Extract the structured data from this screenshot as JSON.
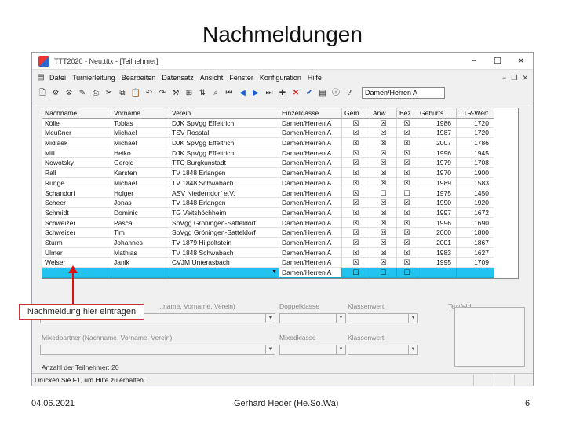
{
  "slide": {
    "title": "Nachmeldungen",
    "footer_date": "04.06.2021",
    "footer_author": "Gerhard Heder (He.So.Wa)",
    "footer_page": "6",
    "callout": "Nachmeldung hier eintragen"
  },
  "window": {
    "title": "TTT2020 - Neu.tttx - [Teilnehmer]",
    "minimize": "−",
    "maximize": "☐",
    "close": "✕"
  },
  "menu": [
    "Datei",
    "Turnierleitung",
    "Bearbeiten",
    "Datensatz",
    "Ansicht",
    "Fenster",
    "Konfiguration",
    "Hilfe"
  ],
  "mdi_controls": [
    "−",
    "❐",
    "✕"
  ],
  "toolbar": {
    "class_value": "Damen/Herren A"
  },
  "grid": {
    "headers": [
      "Nachname",
      "Vorname",
      "Verein",
      "Einzelklasse",
      "Gem.",
      "Anw.",
      "Bez.",
      "Geburts...",
      "TTR-Wert"
    ],
    "rows": [
      {
        "nachname": "Kölle",
        "vorname": "Tobias",
        "verein": "DJK SpVgg Effeltrich",
        "klasse": "Damen/Herren A",
        "gem": "☒",
        "anw": "☒",
        "bez": "☒",
        "geb": "1986",
        "ttr": "1720"
      },
      {
        "nachname": "Meußner",
        "vorname": "Michael",
        "verein": "TSV Rosstal",
        "klasse": "Damen/Herren A",
        "gem": "☒",
        "anw": "☒",
        "bez": "☒",
        "geb": "1987",
        "ttr": "1720"
      },
      {
        "nachname": "Midlaek",
        "vorname": "Michael",
        "verein": "DJK SpVgg Effeltrich",
        "klasse": "Damen/Herren A",
        "gem": "☒",
        "anw": "☒",
        "bez": "☒",
        "geb": "2007",
        "ttr": "1786"
      },
      {
        "nachname": "Mill",
        "vorname": "Heiko",
        "verein": "DJK SpVgg Effeltrich",
        "klasse": "Damen/Herren A",
        "gem": "☒",
        "anw": "☒",
        "bez": "☒",
        "geb": "1996",
        "ttr": "1945"
      },
      {
        "nachname": "Nowotsky",
        "vorname": "Gerold",
        "verein": "TTC Burgkunstadt",
        "klasse": "Damen/Herren A",
        "gem": "☒",
        "anw": "☒",
        "bez": "☒",
        "geb": "1979",
        "ttr": "1708"
      },
      {
        "nachname": "Rall",
        "vorname": "Karsten",
        "verein": "TV 1848 Erlangen",
        "klasse": "Damen/Herren A",
        "gem": "☒",
        "anw": "☒",
        "bez": "☒",
        "geb": "1970",
        "ttr": "1900"
      },
      {
        "nachname": "Runge",
        "vorname": "Michael",
        "verein": "TV 1848 Schwabach",
        "klasse": "Damen/Herren A",
        "gem": "☒",
        "anw": "☒",
        "bez": "☒",
        "geb": "1989",
        "ttr": "1583"
      },
      {
        "nachname": "Schandorf",
        "vorname": "Holger",
        "verein": "ASV Niederndorf e.V.",
        "klasse": "Damen/Herren A",
        "gem": "☒",
        "anw": "☐",
        "bez": "☐",
        "geb": "1975",
        "ttr": "1450"
      },
      {
        "nachname": "Scheer",
        "vorname": "Jonas",
        "verein": "TV 1848 Erlangen",
        "klasse": "Damen/Herren A",
        "gem": "☒",
        "anw": "☒",
        "bez": "☒",
        "geb": "1990",
        "ttr": "1920"
      },
      {
        "nachname": "Schmidt",
        "vorname": "Dominic",
        "verein": "TG Veitshöchheim",
        "klasse": "Damen/Herren A",
        "gem": "☒",
        "anw": "☒",
        "bez": "☒",
        "geb": "1997",
        "ttr": "1672"
      },
      {
        "nachname": "Schweizer",
        "vorname": "Pascal",
        "verein": "SpVgg Gröningen-Satteldorf",
        "klasse": "Damen/Herren A",
        "gem": "☒",
        "anw": "☒",
        "bez": "☒",
        "geb": "1996",
        "ttr": "1690"
      },
      {
        "nachname": "Schweizer",
        "vorname": "Tim",
        "verein": "SpVgg Gröningen-Satteldorf",
        "klasse": "Damen/Herren A",
        "gem": "☒",
        "anw": "☒",
        "bez": "☒",
        "geb": "2000",
        "ttr": "1800"
      },
      {
        "nachname": "Sturm",
        "vorname": "Johannes",
        "verein": "TV 1879 Hilpoltstein",
        "klasse": "Damen/Herren A",
        "gem": "☒",
        "anw": "☒",
        "bez": "☒",
        "geb": "2001",
        "ttr": "1867"
      },
      {
        "nachname": "Ulmer",
        "vorname": "Mathias",
        "verein": "TV 1848 Schwabach",
        "klasse": "Damen/Herren A",
        "gem": "☒",
        "anw": "☒",
        "bez": "☒",
        "geb": "1983",
        "ttr": "1627"
      },
      {
        "nachname": "Welser",
        "vorname": "Janik",
        "verein": "CVJM Unterasbach",
        "klasse": "Damen/Herren A",
        "gem": "☒",
        "anw": "☒",
        "bez": "☒",
        "geb": "1995",
        "ttr": "1709"
      }
    ],
    "new_row": {
      "klasse": "Damen/Herren A",
      "gem": "☐",
      "anw": "☐",
      "bez": "☐"
    }
  },
  "form": {
    "partner_label": "...name, Vorname, Verein)",
    "doppelklasse_label": "Doppelklasse",
    "klassenwert_label": "Klassenwert",
    "textfeld_label": "Textfeld",
    "mixed_label": "Mixedpartner (Nachname, Vorname, Verein)",
    "mixedklasse_label": "Mixedklasse",
    "klassenwert2_label": "Klassenwert",
    "count": "Anzahl der Teilnehmer: 20"
  },
  "status": {
    "text": "Drucken Sie F1, um Hilfe zu erhalten."
  }
}
